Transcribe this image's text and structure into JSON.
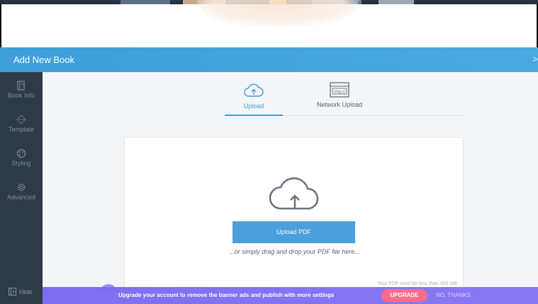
{
  "dialog": {
    "title": "Add New Book",
    "close_hint": ">"
  },
  "sidebar": {
    "items": [
      {
        "label": "Book Info",
        "icon": "book-info-icon"
      },
      {
        "label": "Template",
        "icon": "template-icon"
      },
      {
        "label": "Styling",
        "icon": "styling-icon"
      },
      {
        "label": "Advanced",
        "icon": "gear-icon"
      }
    ],
    "hide_label": "Hide"
  },
  "tabs": [
    {
      "label": "Upload",
      "icon": "cloud-upload-icon",
      "active": true
    },
    {
      "label": "Network Upload",
      "icon": "browser-url-icon",
      "active": false
    }
  ],
  "network_icon_text": "http://",
  "upload": {
    "button_label": "Upload PDF",
    "drag_hint": "...or simply drag and drop your PDF file here...",
    "size_note": "Your PDF must be less than 300 MB"
  },
  "banner": {
    "text": "Upgrade your account to remove the banner ads and publish with more settings",
    "upgrade_label": "UPGRADE",
    "no_thanks_label": "NO, THANKS"
  },
  "colors": {
    "accent": "#3e9fd9",
    "sidebar_bg": "#2e3a46",
    "banner_bg": "#7f6ef0",
    "upgrade_btn": "#ff6b8a"
  }
}
